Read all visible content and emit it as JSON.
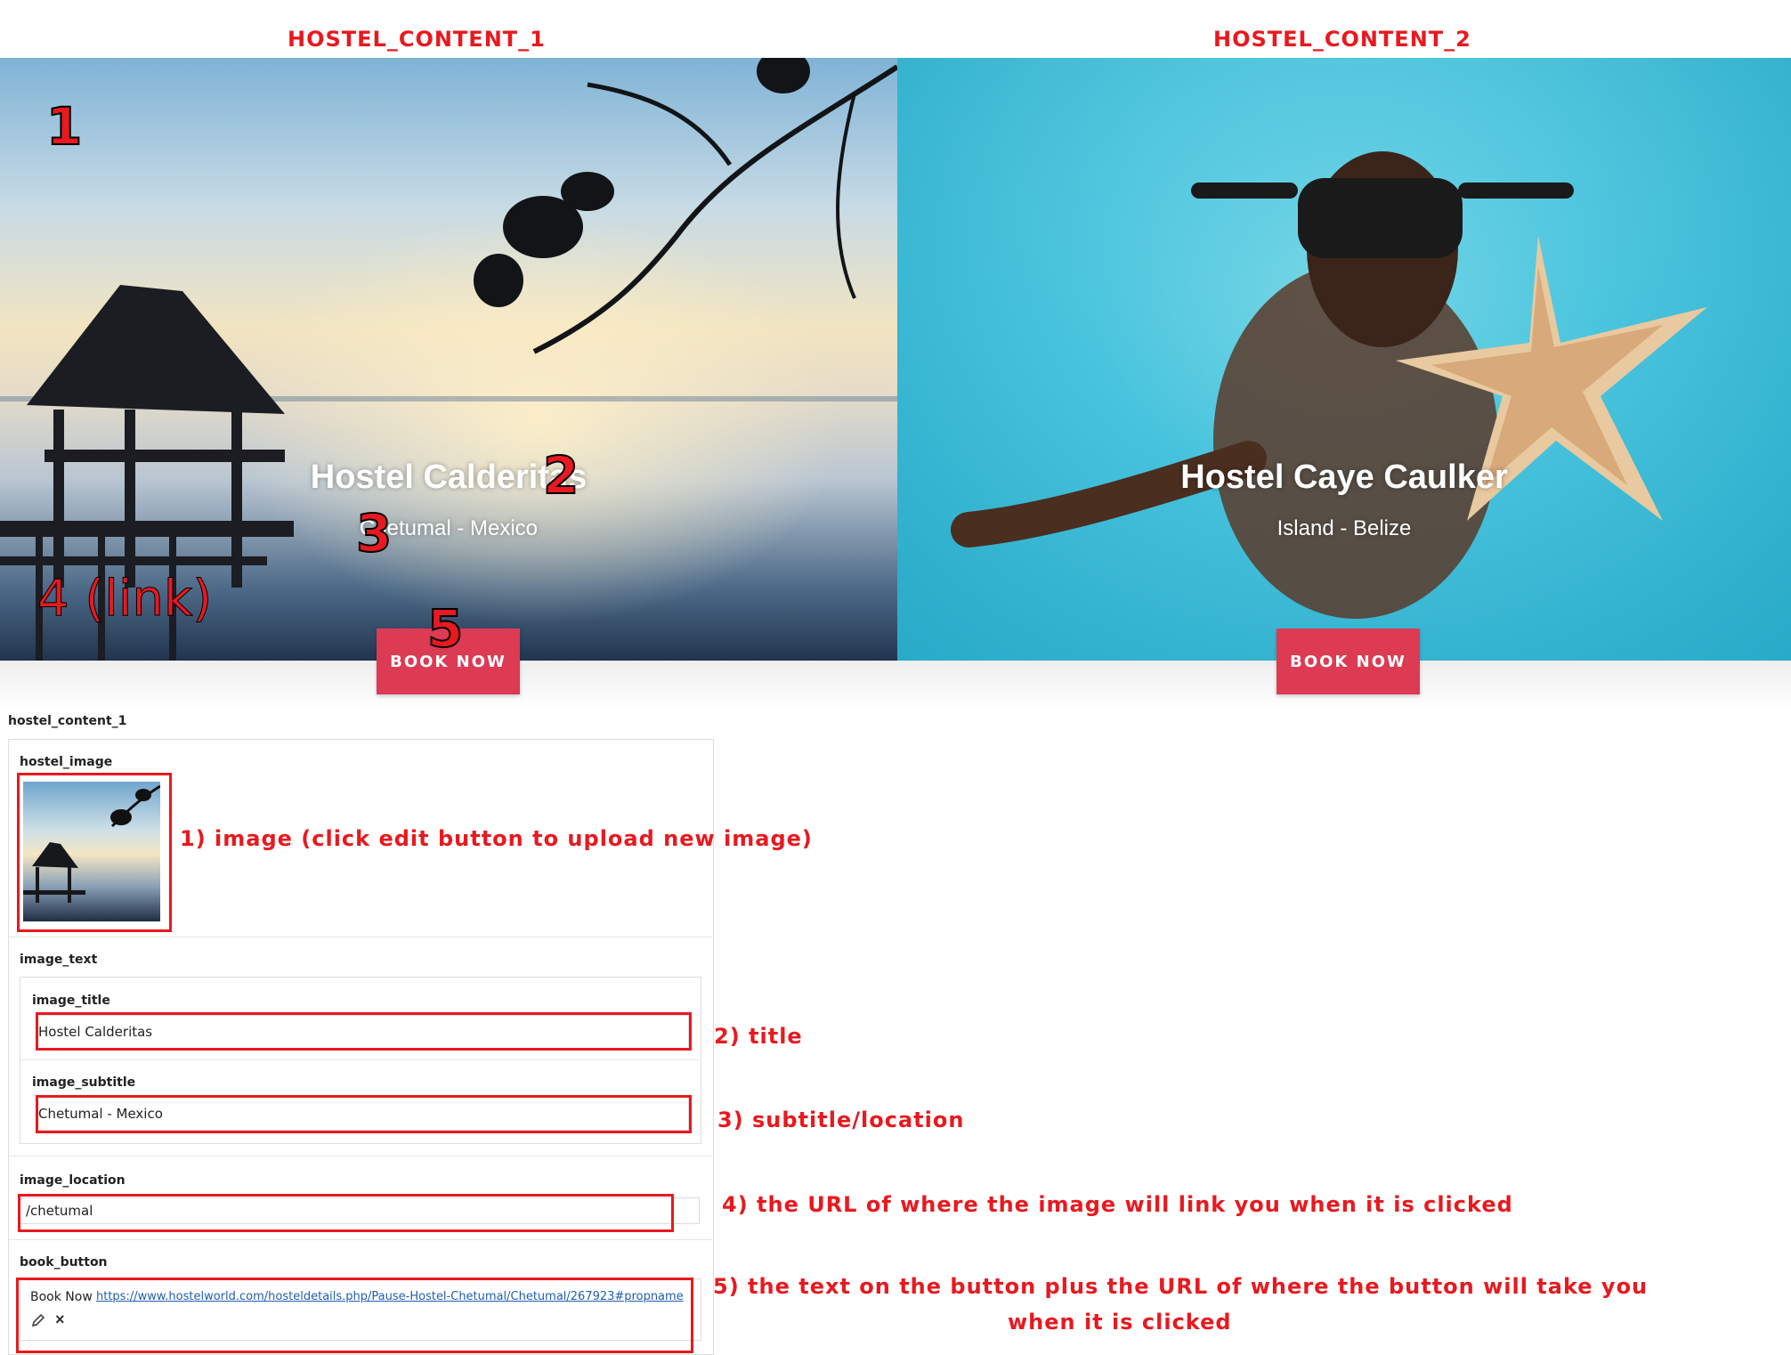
{
  "headings": {
    "left": "HOSTEL_CONTENT_1",
    "right": "HOSTEL_CONTENT_2"
  },
  "hero1": {
    "title": "Hostel Calderitas",
    "subtitle": "Chetumal - Mexico",
    "button": "BOOK NOW"
  },
  "hero2": {
    "title": "Hostel Caye Caulker",
    "subtitle": "Island - Belize",
    "button": "BOOK NOW"
  },
  "markers": {
    "m1": "1",
    "m2": "2",
    "m3": "3",
    "m4": "4 (link)",
    "m5": "5"
  },
  "panel": {
    "group_label": "hostel_content_1",
    "image_label": "hostel_image",
    "image_text_label": "image_text",
    "title_label": "image_title",
    "title_value": "Hostel Calderitas",
    "subtitle_label": "image_subtitle",
    "subtitle_value": "Chetumal - Mexico",
    "location_label": "image_location",
    "location_value": "/chetumal",
    "book_label": "book_button",
    "book_text": "Book Now",
    "book_url": "https://www.hostelworld.com/hosteldetails.php/Pause-Hostel-Chetumal/Chetumal/267923#propname",
    "edit_icon": "pencil-icon",
    "remove_icon": "close-icon"
  },
  "annotations": {
    "a1": "1) image (click edit button to upload new image)",
    "a2": "2) title",
    "a3": "3) subtitle/location",
    "a4": "4) the URL of where the image will link you when it is clicked",
    "a5_line1": "5) the text on the button plus the URL of where the button will take you",
    "a5_line2": "when it is clicked"
  },
  "colors": {
    "annotation_red": "#e8191f",
    "button_red": "#dd3a53"
  }
}
